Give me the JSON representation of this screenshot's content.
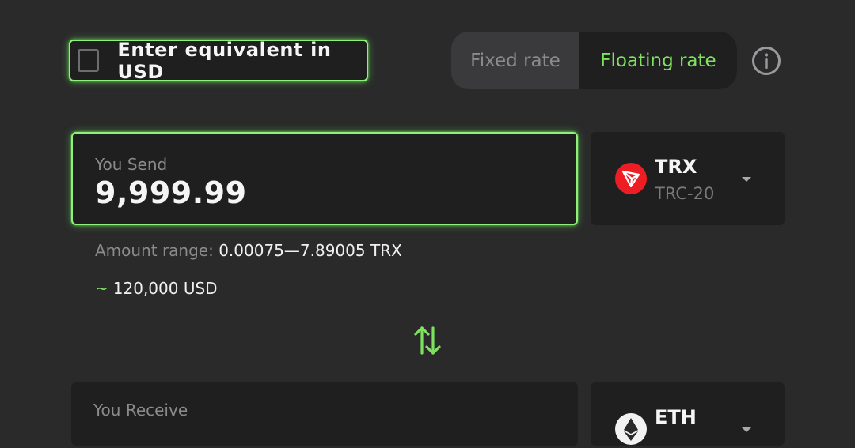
{
  "usd_toggle": {
    "label": "Enter equivalent in USD",
    "checked": false
  },
  "rate_switch": {
    "fixed": "Fixed rate",
    "floating": "Floating rate",
    "selected": "floating"
  },
  "send": {
    "label": "You Send",
    "value": "9,999.99",
    "coin": {
      "ticker": "TRX",
      "network": "TRC-20",
      "icon": "tron-logo-icon"
    },
    "range_label": "Amount range:",
    "range_value": "0.00075—7.89005 TRX",
    "usd_tilde": "~",
    "usd_equivalent": "120,000 USD"
  },
  "receive": {
    "label": "You Receive",
    "coin": {
      "ticker": "ETH",
      "icon": "ethereum-logo-icon"
    }
  },
  "icons": {
    "info": "info-icon",
    "swap": "swap-arrows-icon",
    "dropdown": "caret-down-icon"
  },
  "colors": {
    "accent": "#7fe160",
    "background": "#2a2a2b",
    "panel": "#1f1f20",
    "tron_red": "#ee1d23"
  }
}
